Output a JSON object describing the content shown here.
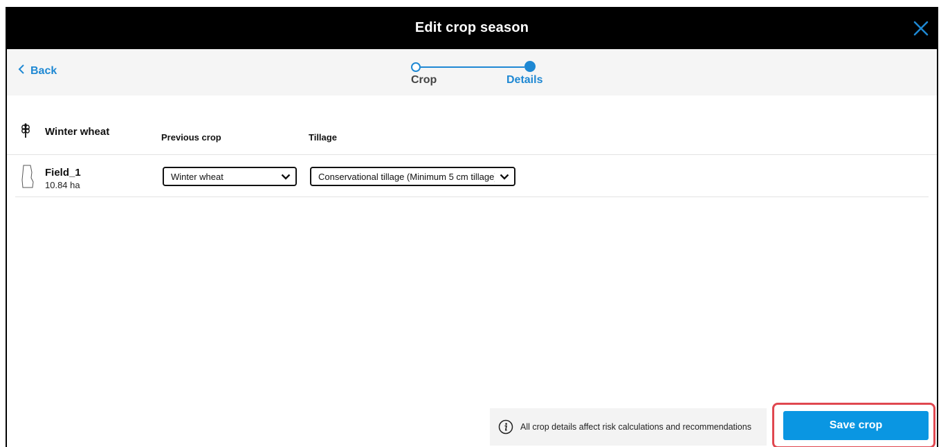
{
  "dialog": {
    "title": "Edit crop season"
  },
  "nav": {
    "back_label": "Back"
  },
  "stepper": {
    "steps": [
      {
        "label": "Crop",
        "state": "done"
      },
      {
        "label": "Details",
        "state": "active"
      }
    ]
  },
  "table": {
    "crop_name": "Winter wheat",
    "columns": {
      "previous_crop": "Previous crop",
      "tillage": "Tillage"
    },
    "rows": [
      {
        "field_name": "Field_1",
        "area": "10.84 ha",
        "previous_crop_value": "Winter wheat",
        "tillage_value": "Conservational tillage (Minimum 5 cm tillage)"
      }
    ]
  },
  "footer": {
    "notice": "All crop details affect risk calculations and recommendations",
    "save_label": "Save crop"
  },
  "colors": {
    "accent": "#1e88d3",
    "button": "#0a96e2",
    "highlight": "#e0474f",
    "titlebar": "#000000"
  }
}
